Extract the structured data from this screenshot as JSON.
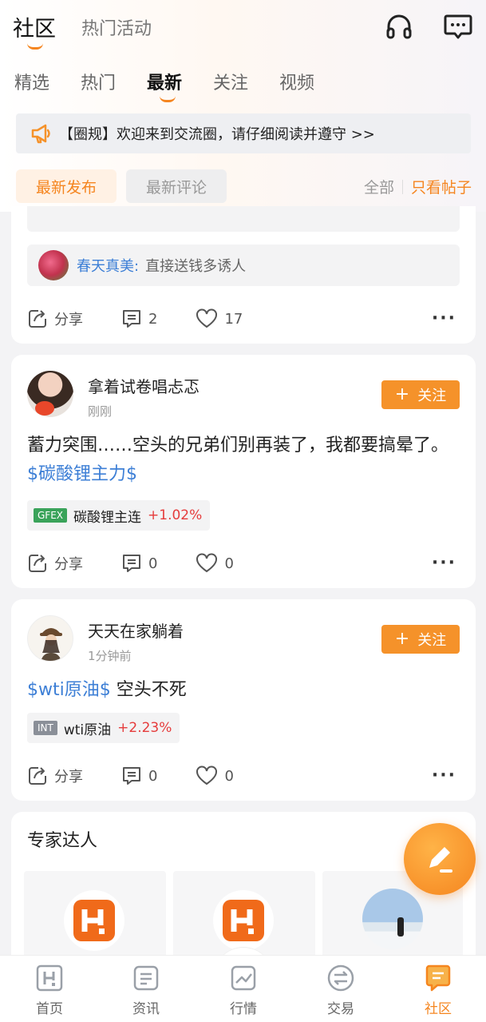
{
  "header": {
    "title": "社区",
    "subtitle": "热门活动",
    "headset_icon": "headset-icon",
    "message_icon": "message-icon"
  },
  "tabs": [
    {
      "label": "精选"
    },
    {
      "label": "热门"
    },
    {
      "label": "最新",
      "active": true
    },
    {
      "label": "关注"
    },
    {
      "label": "视频"
    }
  ],
  "notice": {
    "text": "【圈规】欢迎来到交流圈，请仔细阅读并遵守 >>",
    "icon": "megaphone-icon"
  },
  "filters": {
    "latest_post": "最新发布",
    "latest_comment": "最新评论",
    "all": "全部",
    "posts_only": "只看帖子"
  },
  "post0": {
    "comment_user": "春天真美:",
    "comment_text": "直接送钱多诱人",
    "share": "分享",
    "comments": "2",
    "likes": "17"
  },
  "post1": {
    "user": "拿着试卷唱忐忑",
    "time": "刚刚",
    "follow": "关注",
    "text": "蓄力突围……空头的兄弟们别再装了，我都要搞晕了。",
    "tag": "$碳酸锂主力$",
    "chip_exchange": "GFEX",
    "chip_name": "碳酸锂主连",
    "chip_pct": "+1.02%",
    "share": "分享",
    "comments": "0",
    "likes": "0"
  },
  "post2": {
    "user": "天天在家躺着",
    "time": "1分钟前",
    "follow": "关注",
    "tag": "$wti原油$",
    "text": " 空头不死",
    "chip_exchange": "INT",
    "chip_name": "wti原油",
    "chip_pct": "+2.23%",
    "share": "分享",
    "comments": "0",
    "likes": "0"
  },
  "experts": {
    "title": "专家达人"
  },
  "bottom_nav": [
    {
      "label": "首页",
      "icon": "home-icon"
    },
    {
      "label": "资讯",
      "icon": "news-icon"
    },
    {
      "label": "行情",
      "icon": "market-icon"
    },
    {
      "label": "交易",
      "icon": "trade-icon"
    },
    {
      "label": "社区",
      "icon": "community-icon",
      "active": true
    }
  ],
  "colors": {
    "accent": "#f5851f",
    "link": "#3d7fd6",
    "up": "#e53c3c",
    "gfex": "#3aa35a",
    "int": "#8a8f98"
  }
}
